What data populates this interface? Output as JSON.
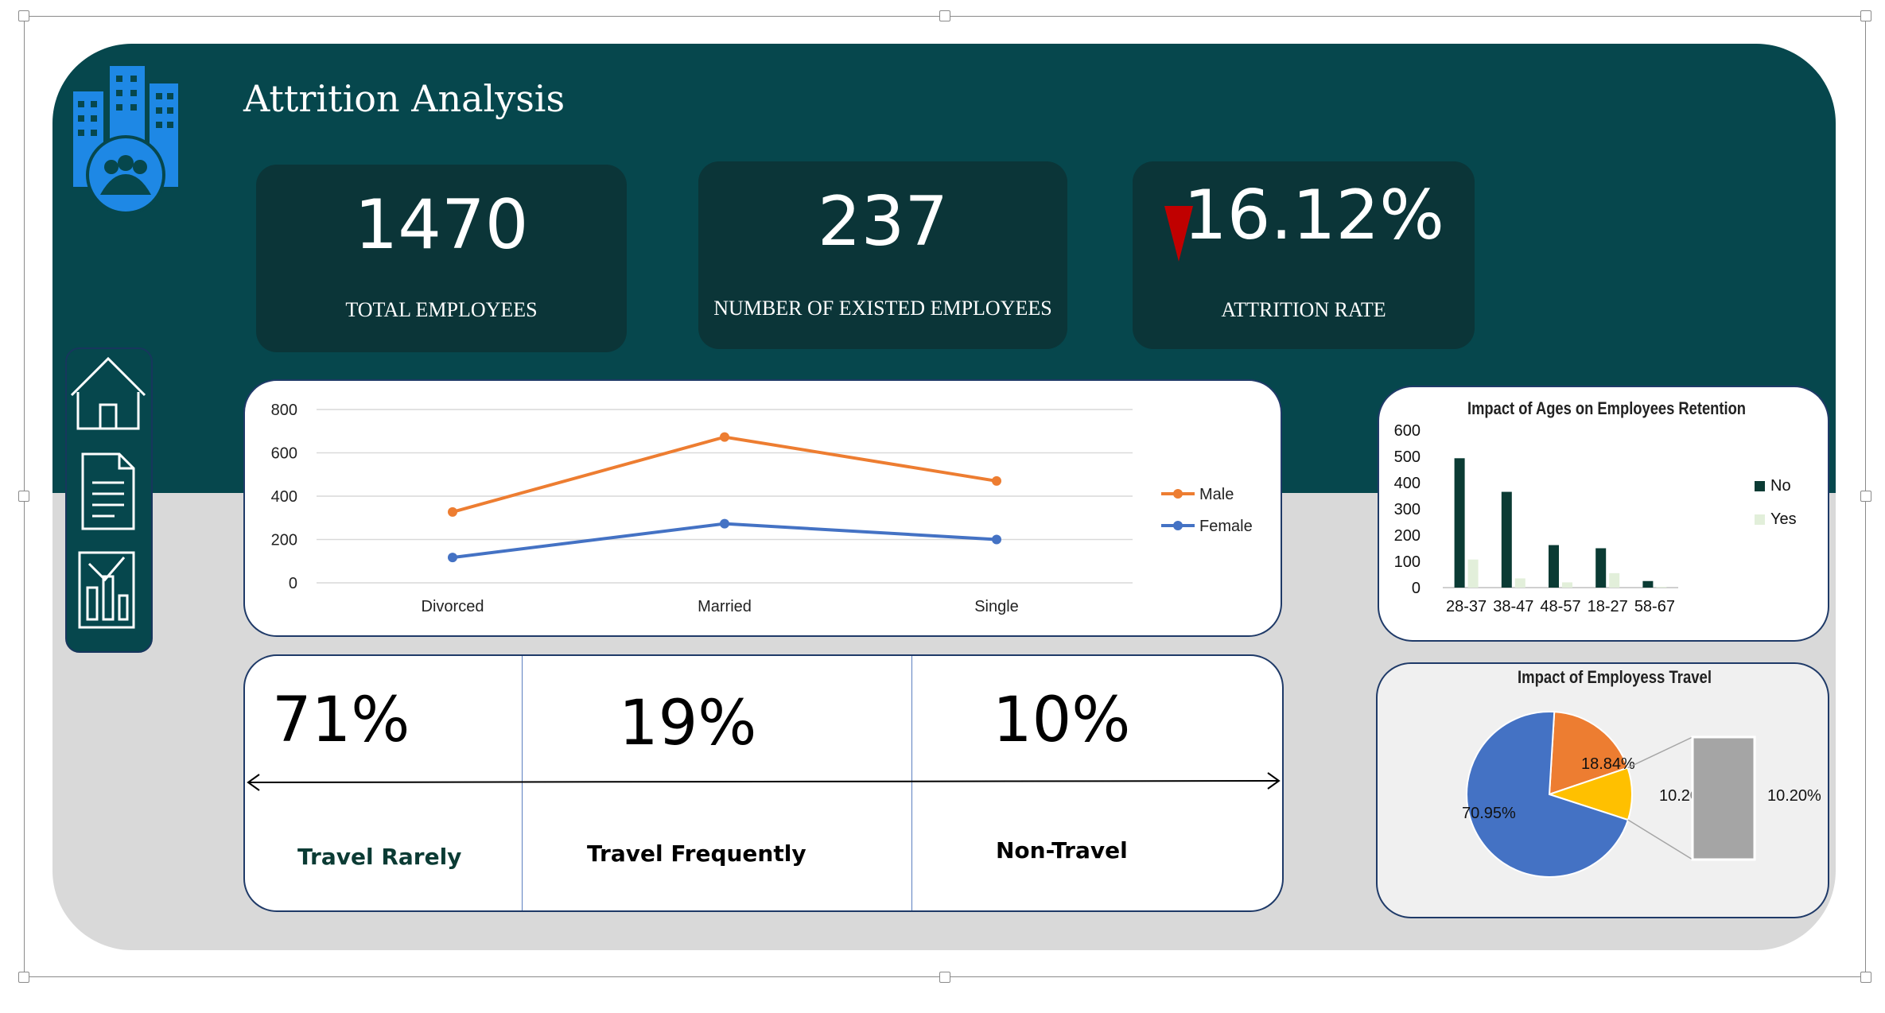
{
  "dashboard": {
    "title": "Attrition Analysis"
  },
  "kpis": {
    "total_employees": {
      "value": "1470",
      "label": "TOTAL EMPLOYEES"
    },
    "existed_employees": {
      "value": "237",
      "label": "NUMBER OF EXISTED EMPLOYEES"
    },
    "attrition_rate": {
      "value": "16.12%",
      "label": "ATTRITION RATE"
    }
  },
  "nav": {
    "icons": [
      "home-icon",
      "document-icon",
      "report-icon"
    ]
  },
  "colors": {
    "header_bg": "#06474d",
    "kpi_bg": "#0b3538",
    "male": "#ed7d31",
    "female": "#4472c4",
    "no": "#0b3b34",
    "yes": "#e2efda",
    "down_arrow": "#c00000"
  },
  "travel": {
    "items": [
      {
        "pct": "71%",
        "label": "Travel Rarely"
      },
      {
        "pct": "19%",
        "label": "Travel Frequently"
      },
      {
        "pct": "10%",
        "label": "Non-Travel"
      }
    ]
  },
  "chart_data": [
    {
      "type": "line",
      "categories": [
        "Divorced",
        "Married",
        "Single"
      ],
      "series": [
        {
          "name": "Male",
          "values": [
            327,
            673,
            470
          ]
        },
        {
          "name": "Female",
          "values": [
            117,
            273,
            200
          ]
        }
      ],
      "ylim": [
        0,
        800
      ],
      "yticks": [
        0,
        200,
        400,
        600,
        800
      ],
      "grid": true,
      "legend": "right"
    },
    {
      "type": "bar",
      "title": "Impact of Ages on Employees Retention",
      "categories": [
        "28-37",
        "38-47",
        "48-57",
        "18-27",
        "58-67"
      ],
      "series": [
        {
          "name": "No",
          "values": [
            493,
            365,
            162,
            150,
            25
          ]
        },
        {
          "name": "Yes",
          "values": [
            107,
            35,
            20,
            55,
            3
          ]
        }
      ],
      "ylim": [
        0,
        600
      ],
      "yticks": [
        0,
        100,
        200,
        300,
        400,
        500,
        600
      ],
      "legend": "right"
    },
    {
      "type": "pie",
      "title": "Impact of Employess Travel",
      "slices": [
        {
          "label": "70.95%",
          "value": 70.95,
          "color": "#4472c4"
        },
        {
          "label": "18.84%",
          "value": 18.84,
          "color": "#ed7d31"
        },
        {
          "label": "10.20%",
          "value": 10.2,
          "color": "#ffc000"
        }
      ],
      "bar_of_pie": {
        "label": "10.20%",
        "value": 10.2,
        "color": "#a5a5a5"
      }
    }
  ]
}
